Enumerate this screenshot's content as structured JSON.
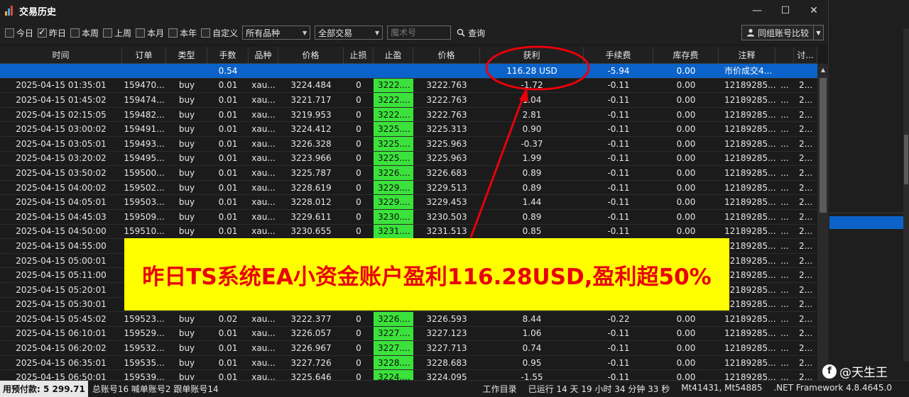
{
  "window": {
    "title": "交易历史",
    "controls": [
      "—",
      "☐",
      "✕"
    ]
  },
  "toolbar": {
    "filters": [
      {
        "label": "今日",
        "checked": false
      },
      {
        "label": "昨日",
        "checked": true
      },
      {
        "label": "本周",
        "checked": false
      },
      {
        "label": "上周",
        "checked": false
      },
      {
        "label": "本月",
        "checked": false
      },
      {
        "label": "本年",
        "checked": false
      },
      {
        "label": "自定义",
        "checked": false
      }
    ],
    "symbol_select": "所有品种",
    "trade_select": "全部交易",
    "magic_placeholder": "魔术号",
    "query_label": "查询",
    "compare_label": "同组账号比较"
  },
  "table": {
    "columns": [
      "时间",
      "订单",
      "类型",
      "手数",
      "品种",
      "价格",
      "止损",
      "止盈",
      "价格",
      "获利",
      "手续费",
      "库存费",
      "注释",
      "",
      "讨..."
    ],
    "summary": {
      "lots": "0.54",
      "profit": "116.28 USD",
      "commission": "-5.94",
      "swap": "0.00",
      "comment": "市价成交4..."
    },
    "rows": [
      [
        "2025-04-15 01:35:01",
        "159470...",
        "buy",
        "0.01",
        "xau...",
        "3224.484",
        "0",
        "3222....",
        "3222.763",
        "-1.72",
        "-0.11",
        "0.00",
        "12189285...",
        "...",
        "2..."
      ],
      [
        "2025-04-15 01:45:02",
        "159474...",
        "buy",
        "0.01",
        "xau...",
        "3221.717",
        "0",
        "3222....",
        "3222.763",
        "1.04",
        "-0.11",
        "0.00",
        "12189285...",
        "...",
        "2..."
      ],
      [
        "2025-04-15 02:15:05",
        "159482...",
        "buy",
        "0.01",
        "xau...",
        "3219.953",
        "0",
        "3222....",
        "3222.763",
        "2.81",
        "-0.11",
        "0.00",
        "12189285...",
        "...",
        "2..."
      ],
      [
        "2025-04-15 03:00:02",
        "159491...",
        "buy",
        "0.01",
        "xau...",
        "3224.412",
        "0",
        "3225....",
        "3225.313",
        "0.90",
        "-0.11",
        "0.00",
        "12189285...",
        "...",
        "2..."
      ],
      [
        "2025-04-15 03:05:01",
        "159493...",
        "buy",
        "0.01",
        "xau...",
        "3226.328",
        "0",
        "3225....",
        "3225.963",
        "-0.37",
        "-0.11",
        "0.00",
        "12189285...",
        "...",
        "2..."
      ],
      [
        "2025-04-15 03:20:02",
        "159495...",
        "buy",
        "0.01",
        "xau...",
        "3223.966",
        "0",
        "3225....",
        "3225.963",
        "1.99",
        "-0.11",
        "0.00",
        "12189285...",
        "...",
        "2..."
      ],
      [
        "2025-04-15 03:50:02",
        "159500...",
        "buy",
        "0.01",
        "xau...",
        "3225.787",
        "0",
        "3226....",
        "3226.683",
        "0.89",
        "-0.11",
        "0.00",
        "12189285...",
        "...",
        "2..."
      ],
      [
        "2025-04-15 04:00:02",
        "159502...",
        "buy",
        "0.01",
        "xau...",
        "3228.619",
        "0",
        "3229....",
        "3229.513",
        "0.89",
        "-0.11",
        "0.00",
        "12189285...",
        "...",
        "2..."
      ],
      [
        "2025-04-15 04:05:01",
        "159503...",
        "buy",
        "0.01",
        "xau...",
        "3228.012",
        "0",
        "3229....",
        "3229.453",
        "1.44",
        "-0.11",
        "0.00",
        "12189285...",
        "...",
        "2..."
      ],
      [
        "2025-04-15 04:45:03",
        "159509...",
        "buy",
        "0.01",
        "xau...",
        "3229.611",
        "0",
        "3230....",
        "3230.503",
        "0.89",
        "-0.11",
        "0.00",
        "12189285...",
        "...",
        "2..."
      ],
      [
        "2025-04-15 04:50:00",
        "159510...",
        "buy",
        "0.01",
        "xau...",
        "3230.655",
        "0",
        "3231....",
        "3231.513",
        "0.85",
        "-0.11",
        "0.00",
        "12189285...",
        "...",
        "2..."
      ],
      [
        "2025-04-15 04:55:00",
        "",
        "",
        "",
        "",
        "",
        "",
        "",
        "",
        "",
        "",
        "",
        "12189285...",
        "...",
        "2..."
      ],
      [
        "2025-04-15 05:00:01",
        "",
        "",
        "",
        "",
        "",
        "",
        "",
        "",
        "",
        "",
        "",
        "12189285...",
        "...",
        "2..."
      ],
      [
        "2025-04-15 05:11:00",
        "",
        "",
        "",
        "",
        "",
        "",
        "",
        "",
        "",
        "",
        "",
        "12189285...",
        "...",
        "2..."
      ],
      [
        "2025-04-15 05:20:01",
        "",
        "",
        "",
        "",
        "",
        "",
        "",
        "",
        "",
        "",
        "",
        "12189285...",
        "...",
        "2..."
      ],
      [
        "2025-04-15 05:30:01",
        "",
        "",
        "",
        "",
        "",
        "",
        "",
        "",
        "",
        "",
        "",
        "12189285...",
        "...",
        "2..."
      ],
      [
        "2025-04-15 05:45:02",
        "159523...",
        "buy",
        "0.02",
        "xau...",
        "3222.377",
        "0",
        "3226....",
        "3226.593",
        "8.44",
        "-0.22",
        "0.00",
        "12189285...",
        "...",
        "2..."
      ],
      [
        "2025-04-15 06:10:01",
        "159529...",
        "buy",
        "0.01",
        "xau...",
        "3226.057",
        "0",
        "3227....",
        "3227.123",
        "1.06",
        "-0.11",
        "0.00",
        "12189285...",
        "...",
        "2..."
      ],
      [
        "2025-04-15 06:20:02",
        "159532...",
        "buy",
        "0.01",
        "xau...",
        "3226.967",
        "0",
        "3227....",
        "3227.713",
        "0.74",
        "-0.11",
        "0.00",
        "12189285...",
        "...",
        "2..."
      ],
      [
        "2025-04-15 06:35:01",
        "159535...",
        "buy",
        "0.01",
        "xau...",
        "3227.726",
        "0",
        "3228....",
        "3228.683",
        "0.95",
        "-0.11",
        "0.00",
        "12189285...",
        "...",
        "2..."
      ],
      [
        "2025-04-15 06:50:01",
        "159539...",
        "buy",
        "0.01",
        "xau...",
        "3225.646",
        "0",
        "3224....",
        "3224.095",
        "-1.55",
        "-0.11",
        "0.00",
        "12189285...",
        "...",
        "2..."
      ]
    ]
  },
  "statusbar": {
    "balance": "用预付款: 5 299.71",
    "accounts": "总账号16 喊单账号2 跟单账号14",
    "work_dir": "工作目录",
    "uptime": "已运行 14 天 19 小时 34 分钟 33 秒",
    "mt_ids": "Mt41431, Mt54885",
    "framework": ".NET Framework 4.8.4645.0"
  },
  "annotation": {
    "banner": "昨日TS系统EA小资金账户盈利116.28USD,盈利超50%",
    "highlight_color": "#e8000b",
    "banner_bg": "#ffff00"
  },
  "watermark": {
    "text": "@天生王"
  },
  "colors": {
    "accent": "#0b63c9",
    "tp_cell": "#3be23b"
  }
}
